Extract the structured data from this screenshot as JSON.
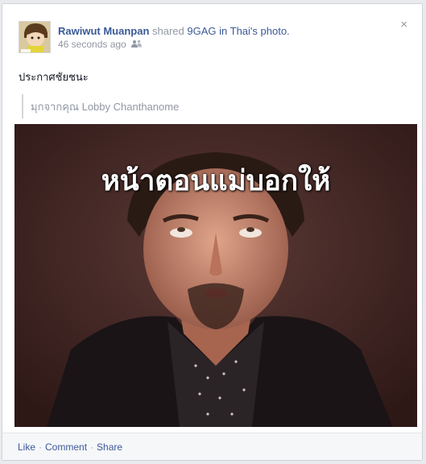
{
  "post": {
    "author": "Rawiwut Muanpan",
    "action_text": "shared",
    "page_name": "9GAG in Thai",
    "suffix": "'s photo.",
    "timestamp": "46 seconds ago",
    "audience_icon": "friends-icon",
    "close_icon": "close-icon",
    "close_label": "×",
    "status_text": "ประกาศชัยชนะ",
    "quote_text": "มุกจากคุณ Lobby Chanthanome",
    "photo": {
      "caption": "หน้าตอนแม่บอกให้"
    },
    "actions": {
      "like": "Like",
      "comment": "Comment",
      "share": "Share",
      "separator": "·"
    }
  }
}
